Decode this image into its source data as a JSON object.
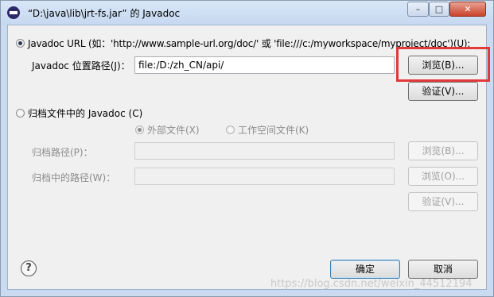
{
  "window": {
    "title": "“D:\\java\\lib\\jrt-fs.jar” 的 Javadoc",
    "controls": {
      "minimize": "–",
      "maximize": "□",
      "close": "✕"
    }
  },
  "url_section": {
    "radio_label": "Javadoc URL (如：'http://www.sample-url.org/doc/' 或 'file:///c:/myworkspace/myproject/doc')(U):",
    "radio_selected": true,
    "location_label": "Javadoc 位置路径(J)：",
    "location_value": "file:/D:/zh_CN/api/",
    "browse_button": "浏览(B)...",
    "validate_button": "验证(V)..."
  },
  "archive_section": {
    "radio_label": "归档文件中的 Javadoc (C)",
    "radio_selected": false,
    "external_file_label": "外部文件(X)",
    "external_file_selected": true,
    "workspace_file_label": "工作空间文件(K)",
    "workspace_file_selected": false,
    "archive_path_label": "归档路径(P)：",
    "archive_path_value": "",
    "archive_browse_button": "浏览(B)...",
    "path_in_archive_label": "归档中的路径(W)：",
    "path_in_archive_value": "",
    "path_browse_button": "浏览(O)...",
    "validate_button": "验证(V)..."
  },
  "footer": {
    "help_icon": "?",
    "ok_button": "确定",
    "cancel_button": "取消"
  },
  "watermark": "https://blog.csdn.net/weixin_44512194",
  "colors": {
    "highlight": "#e03a3a",
    "title_bar": "#c9daf1"
  }
}
